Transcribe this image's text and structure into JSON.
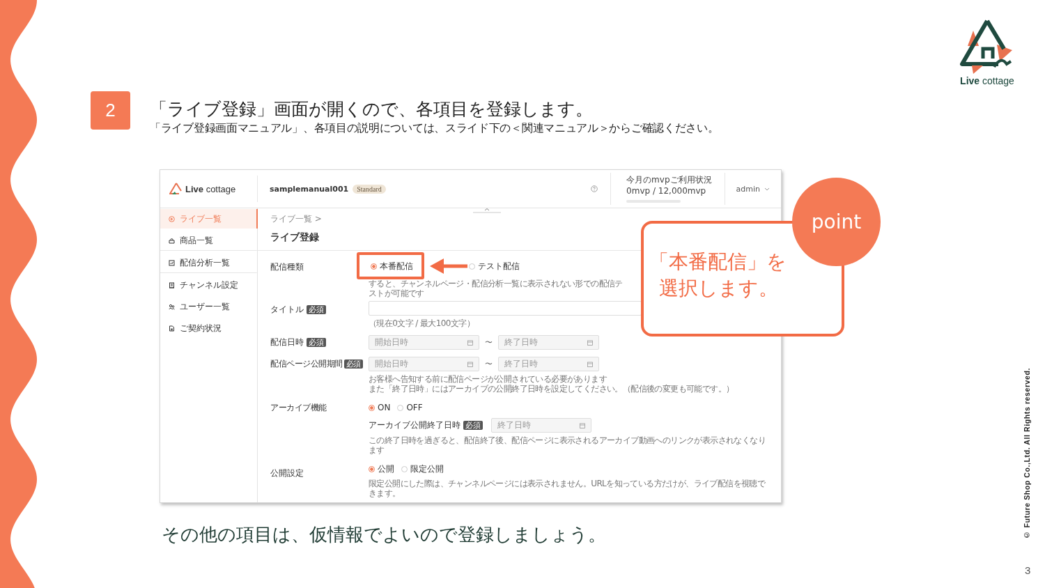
{
  "slide": {
    "step": "2",
    "heading": "「ライブ登録」画面が開くので、各項目を登録します。",
    "subheading": "「ライブ登録画面マニュアル」、各項目の説明については、スライド下の＜関連マニュアル＞からご確認ください。",
    "footer_text": "その他の項目は、仮情報でよいので登録しましょう。",
    "logo_text": "**Live** cottage",
    "copyright": "© Future Shop Co.,Ltd. All Rights reserved.",
    "page_number": "3"
  },
  "app": {
    "header": {
      "logo_text": "**Live** cottage",
      "account": "samplemanual001",
      "plan": "Standard",
      "usage": {
        "title": "今月のmvpご利用状況",
        "value": "0mvp / 12,000mvp",
        "level": 0
      },
      "user": "admin"
    },
    "sidebar": [
      {
        "label": "ライブ一覧",
        "selected": true
      },
      {
        "label": "商品一覧",
        "selected": false
      },
      {
        "label": "配信分析一覧",
        "selected": false
      },
      {
        "label": "チャンネル設定",
        "selected": false
      },
      {
        "label": "ユーザー一覧",
        "selected": false
      },
      {
        "label": "ご契約状況",
        "selected": false
      }
    ],
    "breadcrumb": "ライブ一覧 >",
    "page_title": "ライブ登録",
    "form": [
      {
        "kind": "radio",
        "label": "配信種類",
        "options": [
          {
            "label": "本番配信",
            "selected": true,
            "highlighted": true
          },
          {
            "label": "テスト配信",
            "selected": false,
            "highlighted": false
          }
        ],
        "hints": [
          "すると、チャンネルページ・配信分析一覧に表示されない形での配信テストが可能です"
        ]
      },
      {
        "kind": "text",
        "label": "タイトル",
        "badge": "必須",
        "hints": [
          "（現在0文字 / 最大100文字）"
        ]
      },
      {
        "kind": "daterange",
        "label": "配信日時",
        "badge": "必須",
        "start_placeholder": "開始日時",
        "separator": "〜",
        "end_placeholder": "終了日時"
      },
      {
        "kind": "daterange",
        "label": "配信ページ公開期間",
        "badge": "必須",
        "start_placeholder": "開始日時",
        "separator": "〜",
        "end_placeholder": "終了日時",
        "hints": [
          "お客様へ告知する前に配信ページが公開されている必要があります",
          "また「終了日時」にはアーカイブの公開終了日時を設定してください。（配信後の変更も可能です。）"
        ]
      },
      {
        "kind": "radio",
        "label": "アーカイブ機能",
        "options": [
          {
            "label": "ON",
            "selected": true,
            "highlighted": false
          },
          {
            "label": "OFF",
            "selected": false,
            "highlighted": false
          }
        ],
        "sub": {
          "label": "アーカイブ公開終了日時",
          "badge": "必須",
          "placeholder": "終了日時"
        },
        "hints": [
          "この終了日時を過ぎると、配信終了後、配信ページに表示されるアーカイブ動画へのリンクが表示されなくなります"
        ]
      },
      {
        "kind": "radio",
        "label": "公開設定",
        "options": [
          {
            "label": "公開",
            "selected": true,
            "highlighted": false
          },
          {
            "label": "限定公開",
            "selected": false,
            "highlighted": false
          }
        ],
        "hints": [
          "限定公開にした際は、チャンネルページには表示されません。URLを知っている方だけが、ライブ配信を視聴できます。"
        ]
      }
    ]
  },
  "callout": {
    "badge": "point",
    "lines": [
      "「本番配信」を",
      "選択します。"
    ]
  }
}
